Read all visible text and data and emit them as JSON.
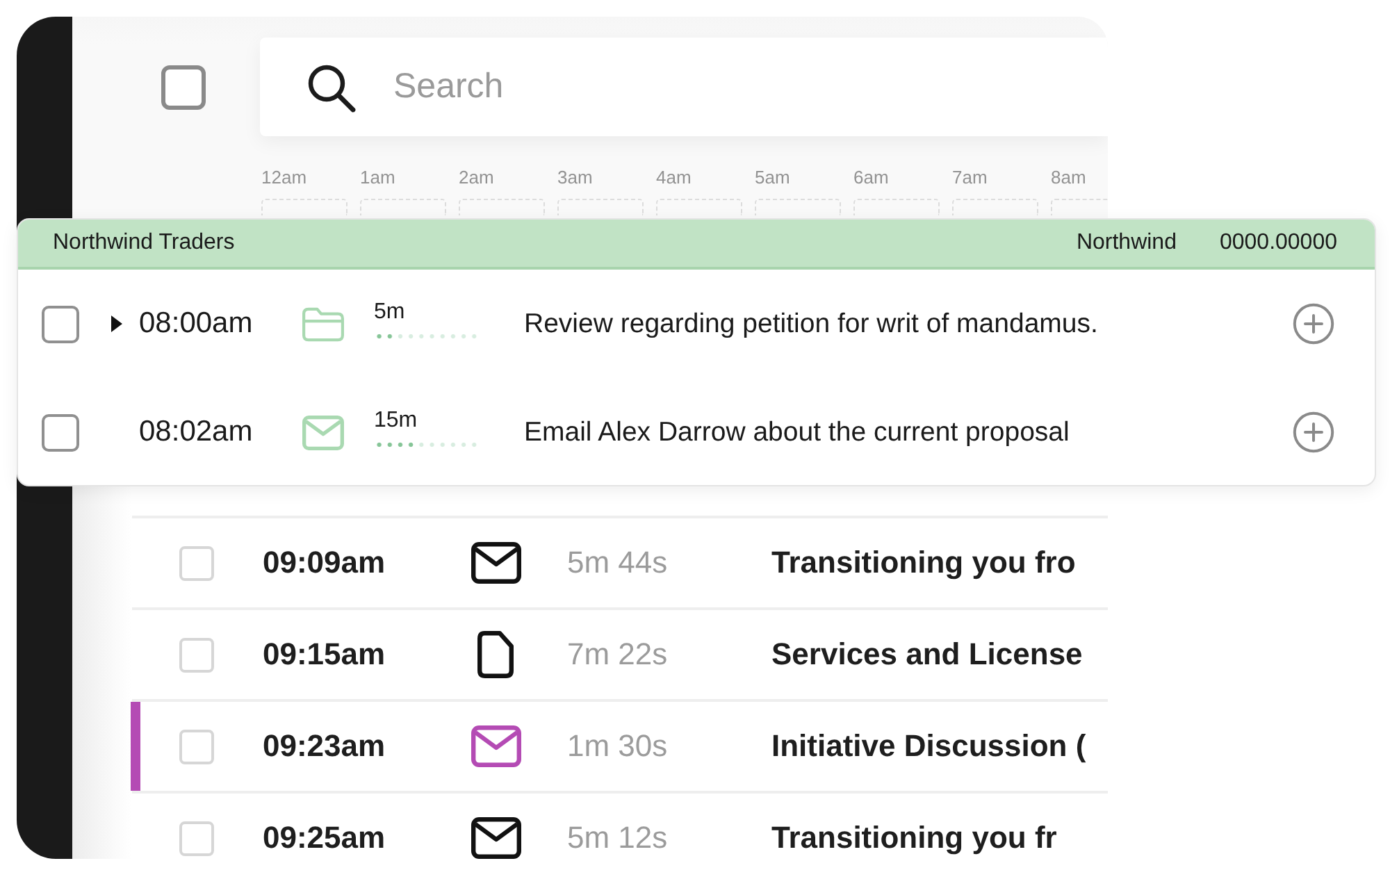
{
  "header": {
    "select_all": {
      "checked": false
    },
    "search": {
      "placeholder": "Search"
    }
  },
  "timeline": {
    "hours": [
      "12am",
      "1am",
      "2am",
      "3am",
      "4am",
      "5am",
      "6am",
      "7am",
      "8am"
    ]
  },
  "activities": [
    {
      "checked": false,
      "time": "09:09am",
      "kind": "email",
      "color": "#111111",
      "highlighted": false,
      "duration": "5m 44s",
      "title": "Transitioning you fro"
    },
    {
      "checked": false,
      "time": "09:15am",
      "kind": "document",
      "color": "#111111",
      "highlighted": false,
      "duration": "7m 22s",
      "title": "Services and License"
    },
    {
      "checked": false,
      "time": "09:23am",
      "kind": "email",
      "color": "#b44bb4",
      "highlighted": true,
      "duration": "1m 30s",
      "title": "Initiative Discussion ("
    },
    {
      "checked": false,
      "time": "09:25am",
      "kind": "email",
      "color": "#111111",
      "highlighted": false,
      "duration": "5m 12s",
      "title": "Transitioning you fr"
    }
  ],
  "popup": {
    "client": "Northwind Traders",
    "matter": "Northwind",
    "number": "0000.00000",
    "entries": [
      {
        "checked": false,
        "expandable": true,
        "time": "08:00am",
        "kind": "folder",
        "duration": "5m",
        "level": 0.2,
        "description": "Review regarding petition for writ of mandamus."
      },
      {
        "checked": false,
        "expandable": false,
        "time": "08:02am",
        "kind": "email",
        "duration": "15m",
        "level": 0.4,
        "description": "Email Alex Darrow about the current proposal"
      }
    ]
  }
}
